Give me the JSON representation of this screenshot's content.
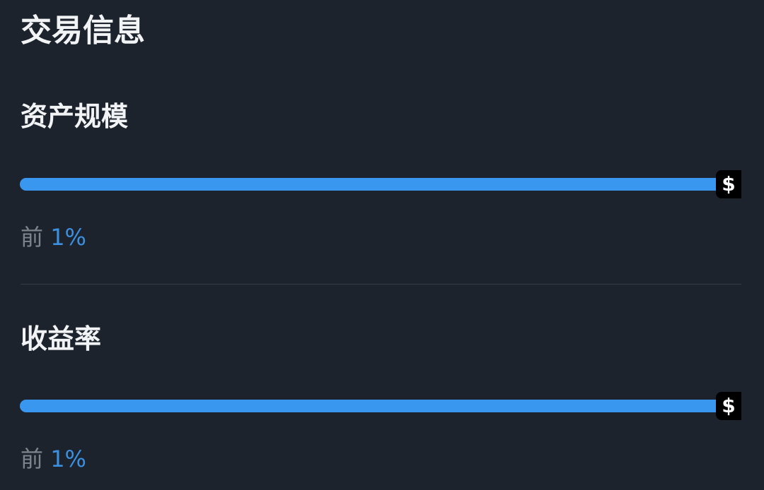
{
  "section": {
    "title": "交易信息"
  },
  "metrics": [
    {
      "label": "资产规模",
      "rank_prefix": "前",
      "rank_value": "1%",
      "progress": 1.0,
      "badge_icon": "dollar-icon",
      "badge_glyph": "$"
    },
    {
      "label": "收益率",
      "rank_prefix": "前",
      "rank_value": "1%",
      "progress": 1.0,
      "badge_icon": "dollar-icon",
      "badge_glyph": "$"
    }
  ],
  "colors": {
    "background": "#1c232c",
    "accent": "#3d8fdf",
    "bar": "#3a97f0",
    "text_primary": "#f1f3f5",
    "text_secondary": "#7d848c"
  }
}
